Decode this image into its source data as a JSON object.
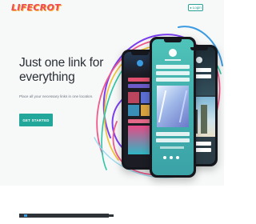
{
  "brand": {
    "logo_text": "LIFECROT"
  },
  "header": {
    "login_label": "Login",
    "login_icon": "user-icon"
  },
  "hero": {
    "headline": "Just one link for everything",
    "subheadline": "Place all your necessary links in one location.",
    "cta_label": "GET STARTED"
  },
  "colors": {
    "accent": "#23a79a",
    "logo": "#ef4a5b",
    "logo_shadow": "#f9b233",
    "hero_background": "#f7f8f8",
    "headline": "#2a2f36"
  },
  "illustration": {
    "icon_names": [
      "phone-mockup-left",
      "phone-mockup-center",
      "phone-mockup-right",
      "decorative-wave-lines"
    ]
  }
}
